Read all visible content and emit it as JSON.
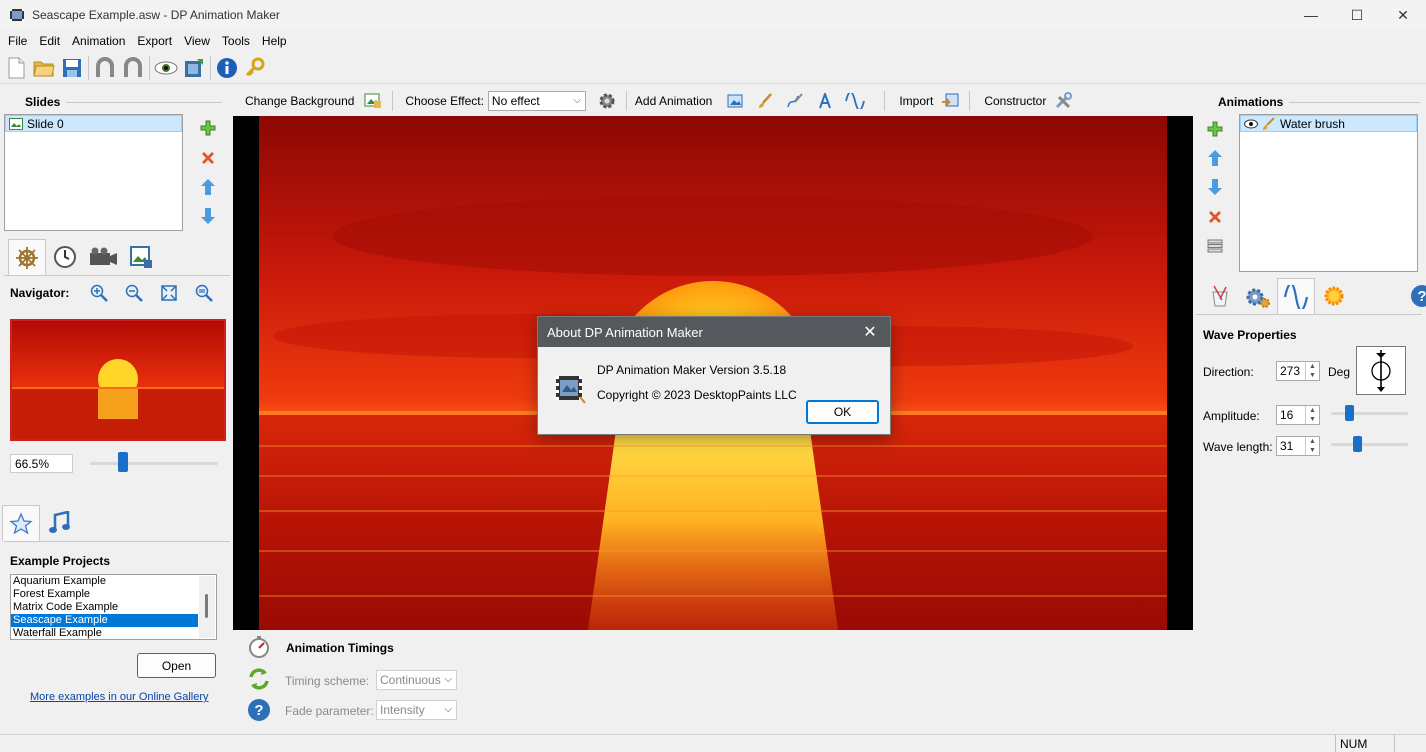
{
  "window": {
    "title": "Seascape Example.asw - DP Animation Maker",
    "minimize_glyph": "—",
    "maximize_glyph": "☐",
    "close_glyph": "✕"
  },
  "menu": [
    "File",
    "Edit",
    "Animation",
    "Export",
    "View",
    "Tools",
    "Help"
  ],
  "toolbar": {
    "icons": [
      "new-file-icon",
      "open-folder-icon",
      "save-icon",
      "undo-icon",
      "redo-icon",
      "preview-eye-icon",
      "export-film-icon",
      "info-icon",
      "key-icon"
    ]
  },
  "slides": {
    "title": "Slides",
    "items": [
      "Slide 0"
    ],
    "buttons": [
      "add-icon",
      "delete-icon",
      "move-up-icon",
      "move-down-icon"
    ]
  },
  "left_tabs": [
    "helm-icon",
    "clock-icon",
    "camera-icon",
    "image-icon"
  ],
  "navigator": {
    "label": "Navigator:",
    "zoom": "66.5%",
    "zoom_fraction": 0.24,
    "buttons": [
      "zoom-in-icon",
      "zoom-out-icon",
      "fit-icon",
      "zoom-reset-icon"
    ]
  },
  "examples": {
    "tabs": [
      "star-icon",
      "music-note-icon"
    ],
    "title": "Example Projects",
    "items": [
      "Aquarium Example",
      "Forest Example",
      "Matrix Code Example",
      "Seascape Example",
      "Waterfall Example"
    ],
    "selected_index": 3,
    "open_label": "Open",
    "gallery_link": "More examples in our Online Gallery"
  },
  "edit_toolbar": {
    "change_background": "Change Background",
    "choose_effect_label": "Choose Effect:",
    "effect_value": "No effect",
    "add_animation": "Add Animation",
    "import": "Import",
    "constructor": "Constructor"
  },
  "timings": {
    "title": "Animation Timings",
    "timing_scheme_label": "Timing scheme:",
    "timing_scheme_value": "Continuous",
    "fade_parameter_label": "Fade parameter:",
    "fade_parameter_value": "Intensity"
  },
  "animations": {
    "title": "Animations",
    "items": [
      "Water brush"
    ]
  },
  "right_tabs": [
    "brush-cup-icon",
    "gears-icon",
    "wave-icon",
    "sun-icon",
    "help-icon"
  ],
  "wave": {
    "title": "Wave Properties",
    "direction_label": "Direction:",
    "direction_value": "273",
    "direction_unit": "Deg",
    "amplitude_label": "Amplitude:",
    "amplitude_value": "16",
    "amplitude_fraction": 0.2,
    "wavelength_label": "Wave length:",
    "wavelength_value": "31",
    "wavelength_fraction": 0.32
  },
  "dialog": {
    "title": "About DP Animation Maker",
    "version": "DP Animation Maker Version 3.5.18",
    "copyright": "Copyright © 2023 DesktopPaints LLC",
    "ok_label": "OK"
  },
  "status": {
    "num": "NUM"
  },
  "colors": {
    "accent": "#0078d7",
    "selection_light": "#cce8ff",
    "dialog_header": "#55595e",
    "sky_red": "#d41a0a",
    "sun_yellow": "#ffe030"
  }
}
